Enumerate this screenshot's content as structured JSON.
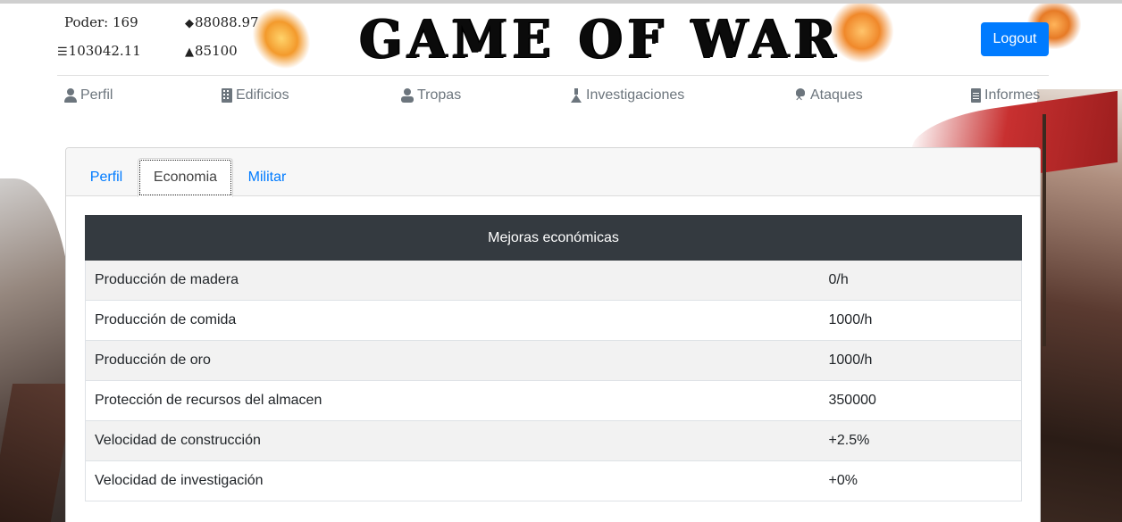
{
  "header": {
    "stats": {
      "power_label": "Poder: 169",
      "food": "88088.97",
      "gold": "103042.11",
      "wood": "85100"
    },
    "logo_text": "GAME OF WAR",
    "logout_label": "Logout"
  },
  "nav": {
    "items": [
      {
        "label": "Perfil",
        "icon": "user-icon"
      },
      {
        "label": "Edificios",
        "icon": "building-icon"
      },
      {
        "label": "Tropas",
        "icon": "troops-icon"
      },
      {
        "label": "Investigaciones",
        "icon": "flask-icon"
      },
      {
        "label": "Ataques",
        "icon": "skull-crossbones-icon"
      },
      {
        "label": "Informes",
        "icon": "file-icon"
      }
    ]
  },
  "tabs": [
    {
      "label": "Perfil",
      "active": false
    },
    {
      "label": "Economia",
      "active": true
    },
    {
      "label": "Militar",
      "active": false
    }
  ],
  "table": {
    "header": "Mejoras económicas",
    "rows": [
      {
        "label": "Producción de madera",
        "value": "0/h"
      },
      {
        "label": "Producción de comida",
        "value": "1000/h"
      },
      {
        "label": "Producción de oro",
        "value": "1000/h"
      },
      {
        "label": "Protección de recursos del almacen",
        "value": "350000"
      },
      {
        "label": "Velocidad de construcción",
        "value": "+2.5%"
      },
      {
        "label": "Velocidad de investigación",
        "value": "+0%"
      }
    ]
  },
  "colors": {
    "primary": "#007bff",
    "table_header_bg": "#343a40",
    "nav_text": "#6c757d"
  }
}
